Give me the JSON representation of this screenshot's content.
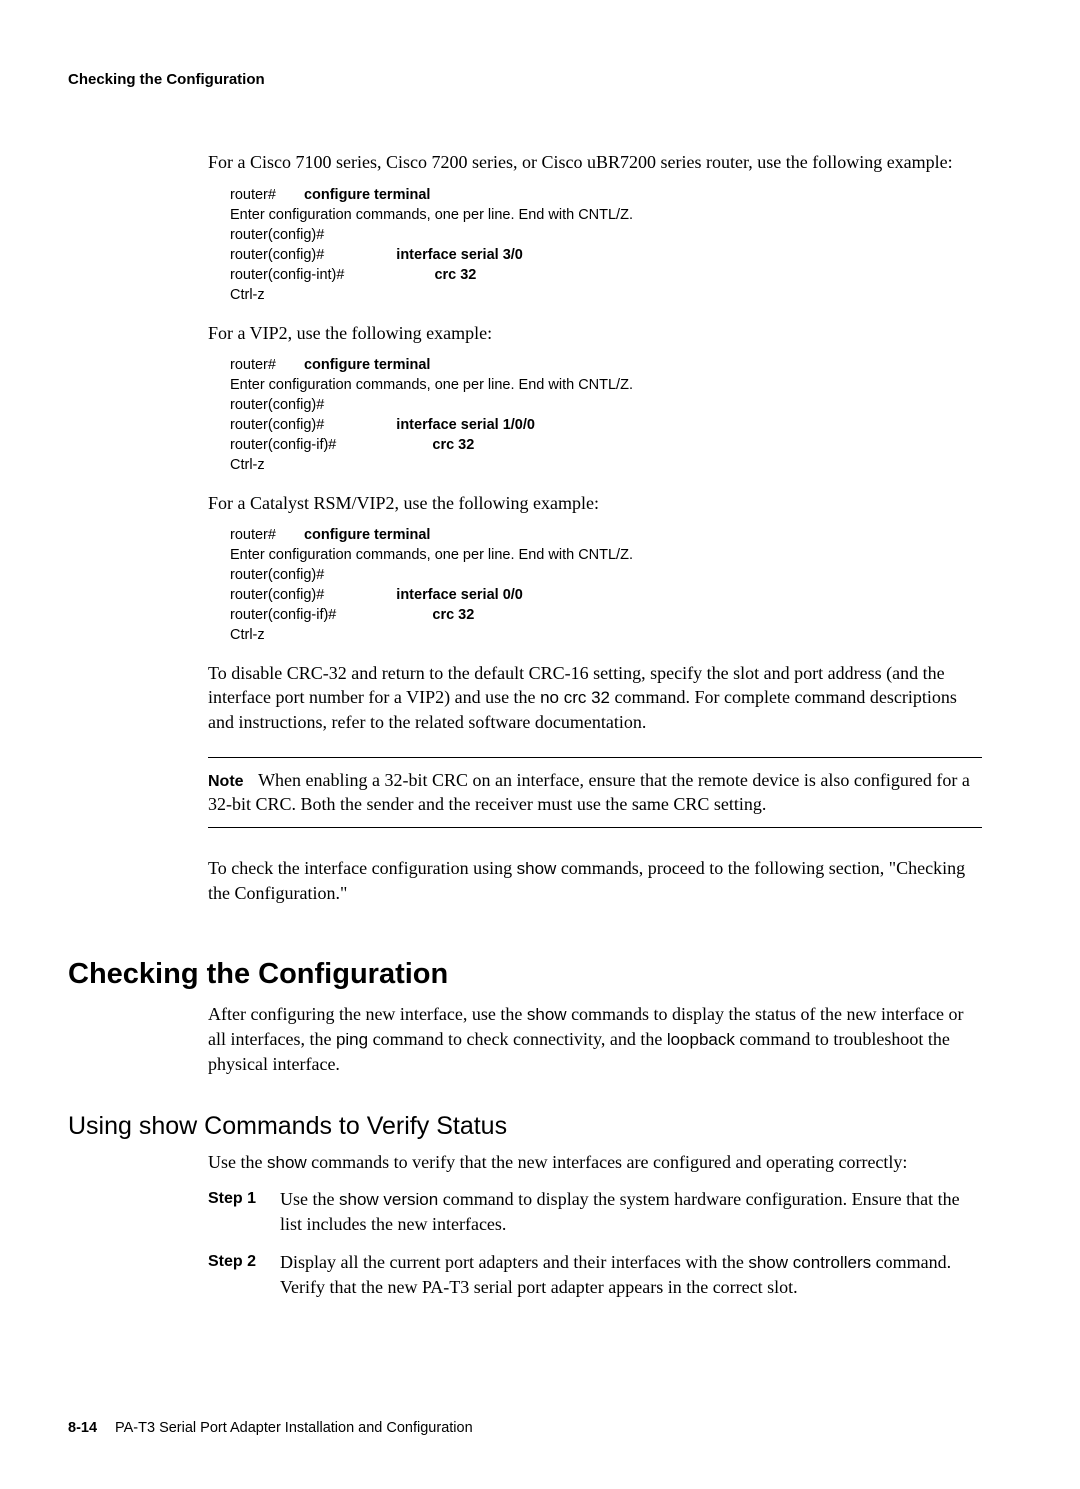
{
  "header": {
    "running": "Checking the Configuration"
  },
  "intro": {
    "p1": "For a Cisco 7100 series, Cisco 7200 series, or Cisco uBR7200 series router, use the following example:"
  },
  "ex1": {
    "l1a": "router#",
    "l1b": "configure terminal",
    "l2": "Enter configuration commands, one per line.  End with CNTL/Z.",
    "l3": "router(config)#",
    "l4a": "router(config)#",
    "l4b": "interface serial 3/0",
    "l5a": "router(config-int)#",
    "l5b": "crc 32",
    "l6": "Ctrl-z"
  },
  "p_vip2": "For a VIP2, use the following example:",
  "ex2": {
    "l1a": "router#",
    "l1b": "configure terminal",
    "l2": "Enter configuration commands, one per line.  End with CNTL/Z.",
    "l3": "router(config)#",
    "l4a": "router(config)#",
    "l4b": "interface serial 1/0/0",
    "l5a": "router(config-if)#",
    "l5b": "crc 32",
    "l6": "Ctrl-z"
  },
  "p_cat": "For a Catalyst RSM/VIP2, use the following example:",
  "ex3": {
    "l1a": "router#",
    "l1b": "configure terminal",
    "l2": "Enter configuration commands, one per line.  End with CNTL/Z.",
    "l3": "router(config)#",
    "l4a": "router(config)#",
    "l4b": "interface serial 0/0",
    "l5a": "router(config-if)#",
    "l5b": "crc 32",
    "l6": "Ctrl-z"
  },
  "disable": {
    "pre": "To disable CRC-32 and return to the default CRC-16 setting, specify the slot and port address (and the interface port number for a VIP2) and use the ",
    "cmd": "no crc 32",
    "post": " command. For complete command descriptions and instructions, refer to the related software documentation."
  },
  "note": {
    "label": "Note",
    "text": "When enabling a 32-bit CRC on an interface, ensure that the remote device is also configured for a 32-bit CRC. Both the sender and the receiver must use the same CRC setting."
  },
  "check_para": {
    "pre": "To check the interface configuration using ",
    "cmd": "show",
    "post": " commands, proceed to the following section, \"Checking the Configuration.\""
  },
  "section_h1": "Checking the Configuration",
  "section_para": {
    "a": "After configuring the new interface, use the ",
    "b": "show",
    "c": " commands to display the status of the new interface or all interfaces, the ",
    "d": "ping",
    "e": " command to check connectivity, and the ",
    "f": "loopback",
    "g": " command to troubleshoot the physical interface."
  },
  "subsection_h2": "Using show Commands to Verify Status",
  "sub_para": {
    "a": "Use the ",
    "b": "show",
    "c": " commands to verify that the new interfaces are configured and operating correctly:"
  },
  "steps": {
    "s1_label": "Step 1",
    "s1_a": "Use the ",
    "s1_b": "show version",
    "s1_c": " command to display the system hardware configuration. Ensure that the list includes the new interfaces.",
    "s2_label": "Step 2",
    "s2_a": "Display all the current port adapters and their interfaces with the ",
    "s2_b": "show controllers",
    "s2_c": " command. Verify that the new PA-T3 serial port adapter appears in the correct slot."
  },
  "footer": {
    "pagenum": "8-14",
    "title": "PA-T3 Serial Port Adapter Installation and Configuration"
  }
}
